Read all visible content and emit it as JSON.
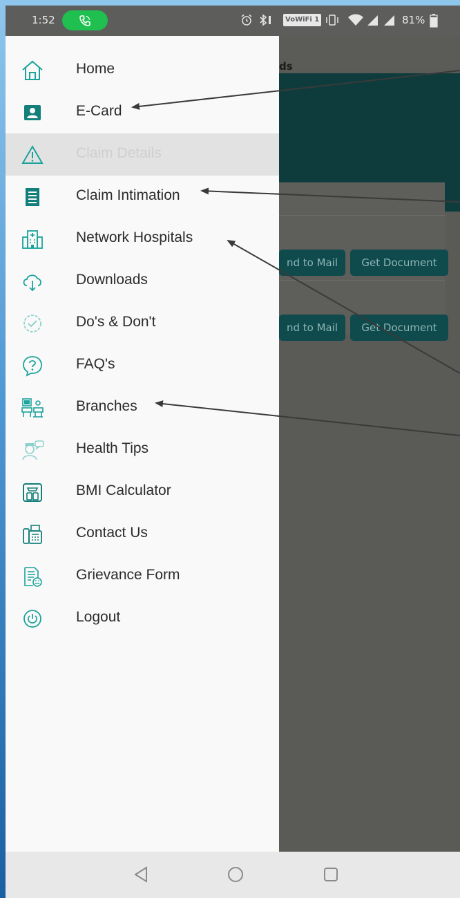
{
  "status_bar": {
    "time": "1:52",
    "vowifi": "VoWiFi 1",
    "battery": "81%"
  },
  "background_app": {
    "header_title": "ds",
    "rows": [
      {
        "send_label": "nd to Mail",
        "get_label": "Get Document"
      },
      {
        "send_label": "nd to Mail",
        "get_label": "Get Document"
      }
    ]
  },
  "drawer": {
    "items": [
      {
        "label": "Home",
        "icon": "home-icon"
      },
      {
        "label": "E-Card",
        "icon": "id-card-icon"
      },
      {
        "label": "Claim Details",
        "icon": "warning-icon",
        "state": "selected-disabled"
      },
      {
        "label": "Claim Intimation",
        "icon": "document-list-icon"
      },
      {
        "label": "Network Hospitals",
        "icon": "hospital-icon"
      },
      {
        "label": "Downloads",
        "icon": "cloud-download-icon"
      },
      {
        "label": "Do's & Don't",
        "icon": "check-badge-icon"
      },
      {
        "label": "FAQ's",
        "icon": "question-icon"
      },
      {
        "label": "Branches",
        "icon": "branches-icon"
      },
      {
        "label": "Health Tips",
        "icon": "doctor-chat-icon"
      },
      {
        "label": "BMI Calculator",
        "icon": "scale-icon"
      },
      {
        "label": "Contact Us",
        "icon": "phone-fax-icon"
      },
      {
        "label": "Grievance Form",
        "icon": "grievance-form-icon"
      },
      {
        "label": "Logout",
        "icon": "power-icon"
      }
    ]
  },
  "nav_bar": {
    "buttons": [
      "back",
      "home",
      "recents"
    ]
  },
  "colors": {
    "accent": "#1aa39b",
    "icon_dark": "#127f7a",
    "drawer_bg": "#f9f9f9",
    "selected_bg": "#e2e2e2",
    "call_pill": "#1fc04f"
  }
}
